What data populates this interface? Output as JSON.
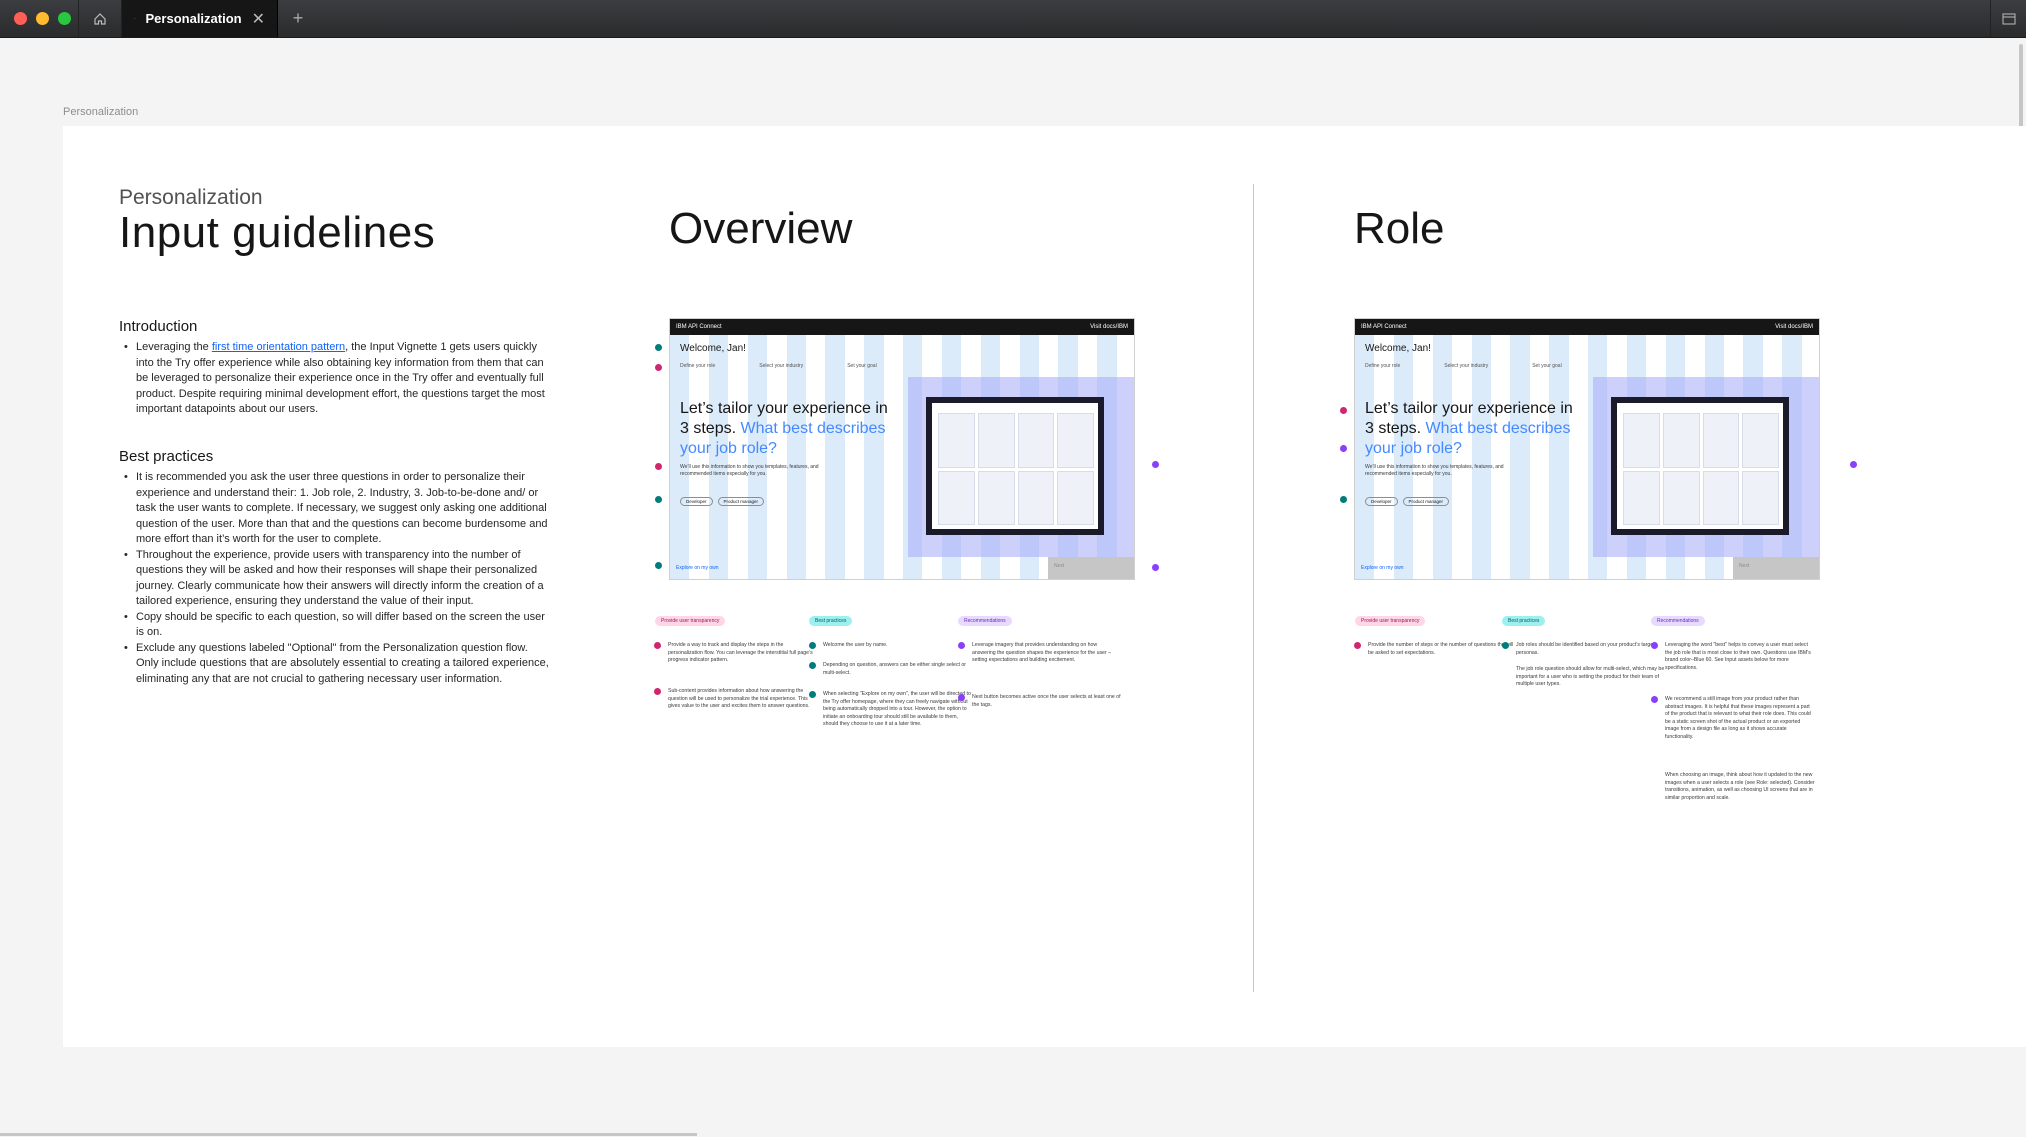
{
  "window": {
    "tab_title": "Personalization",
    "tab_close": "✕",
    "new_tab": "+"
  },
  "breadcrumb": "Personalization",
  "left": {
    "subtitle": "Personalization",
    "title": "Input guidelines",
    "intro_heading": "Introduction",
    "intro_pre": "Leveraging the",
    "intro_link": "first time orientation pattern",
    "intro_post": ", the Input Vignette 1 gets users quickly into the Try offer experience while also obtaining key information from them that can be leveraged to personalize their experience once in the Try offer and eventually full product. Despite requiring minimal development effort, the questions target the most important datapoints about our users.",
    "best_heading": "Best practices",
    "best_items": [
      "It is recommended you ask the user three questions in order to personalize their experience and understand their: 1. Job role, 2. Industry, 3. Job-to-be-done and/ or task the user wants to complete. If necessary, we suggest only asking one additional question of the user. More than that and the questions can become burdensome and more effort than it’s worth for the user to complete.",
      "Throughout the experience, provide users with transparency into the number of questions they will be asked and how their responses will shape their personalized journey. Clearly communicate how their answers will directly inform the creation of a tailored experience, ensuring they understand the value of their input.",
      "Copy should be specific to each question, so will differ based on the screen the user is on.",
      "Exclude any questions labeled \"Optional\" from the Personalization question flow. Only include questions that are absolutely essential to creating a tailored experience, eliminating any that are not crucial to gathering necessary user information."
    ]
  },
  "overview": {
    "heading": "Overview"
  },
  "role": {
    "heading": "Role"
  },
  "mock": {
    "app_name": "IBM API Connect",
    "header_right": "Visit docs/IBM",
    "welcome": "Welcome, Jan!",
    "steps": [
      "Define your role",
      "Select your industry",
      "Set your goal"
    ],
    "headline_pre": "Let’s tailor your experience in 3 steps.",
    "headline_accent": "What best describes your job role?",
    "sub": "We’ll use this information to show you templates, features, and recommended items especially for you.",
    "pills": [
      "Developer",
      "Product manager"
    ],
    "explore": "Explore on my own",
    "next": "Next"
  },
  "overview_notes": {
    "chips": [
      "Provide user transparency",
      "Best practices",
      "Recommendations"
    ],
    "col1": [
      "Provide a way to track and display the steps in the personalization flow. You can leverage the interstitial full page’s progress indicator pattern.",
      "Sub-content provides information about how answering the question will be used to personalize the trial experience. This gives value to the user and excites them to answer questions."
    ],
    "col2": [
      "Welcome the user by name.",
      "Depending on question, answers can be either single select or multi-select.",
      "When selecting \"Explore on my own\", the user will be directed to the Try offer homepage, where they can freely navigate without being automatically dropped into a tour. However, the option to initiate an onboarding tour should still be available to them, should they choose to use it at a later time."
    ],
    "col3": [
      "Leverage imagery that provides understanding on how answering the question shapes the experience for the user – setting expectations and building excitement.",
      "Next button becomes active once the user selects at least one of the tags."
    ]
  },
  "role_notes": {
    "chips": [
      "Provide user transparency",
      "Best practices",
      "Recommendations"
    ],
    "col1": [
      "Provide the number of steps or the number of questions the will be asked to set expectations."
    ],
    "col2": [
      "Job roles should be identified based on your product’s target personas.",
      "The job role question should allow for multi-select, which may be important for a user who is setting the product for their team of multiple user types."
    ],
    "col3": [
      "Leveraging the word \"best\" helps to convey a user must select the job role that is most close to their own. Questions use IBM’s brand color–Blue 60. See Input assets below for more specifications.",
      "We recommend a still image from your product rather than abstract images. It is helpful that these images represent a part of the product that is relevant to what their role does. This could be a static screen shot of the actual product or an exported image from a design file as long as it shows accurate functionality.",
      "When choosing an image, think about how it updated to the new images when a user selects a role (see Role: selected). Consider transitions, animation, as well as choosing UI screens that are in similar proportion and scale."
    ]
  },
  "colors": {
    "teal": "#007d79",
    "pink": "#d02670",
    "purple": "#8a3ffc",
    "accent": "#4589ff"
  }
}
